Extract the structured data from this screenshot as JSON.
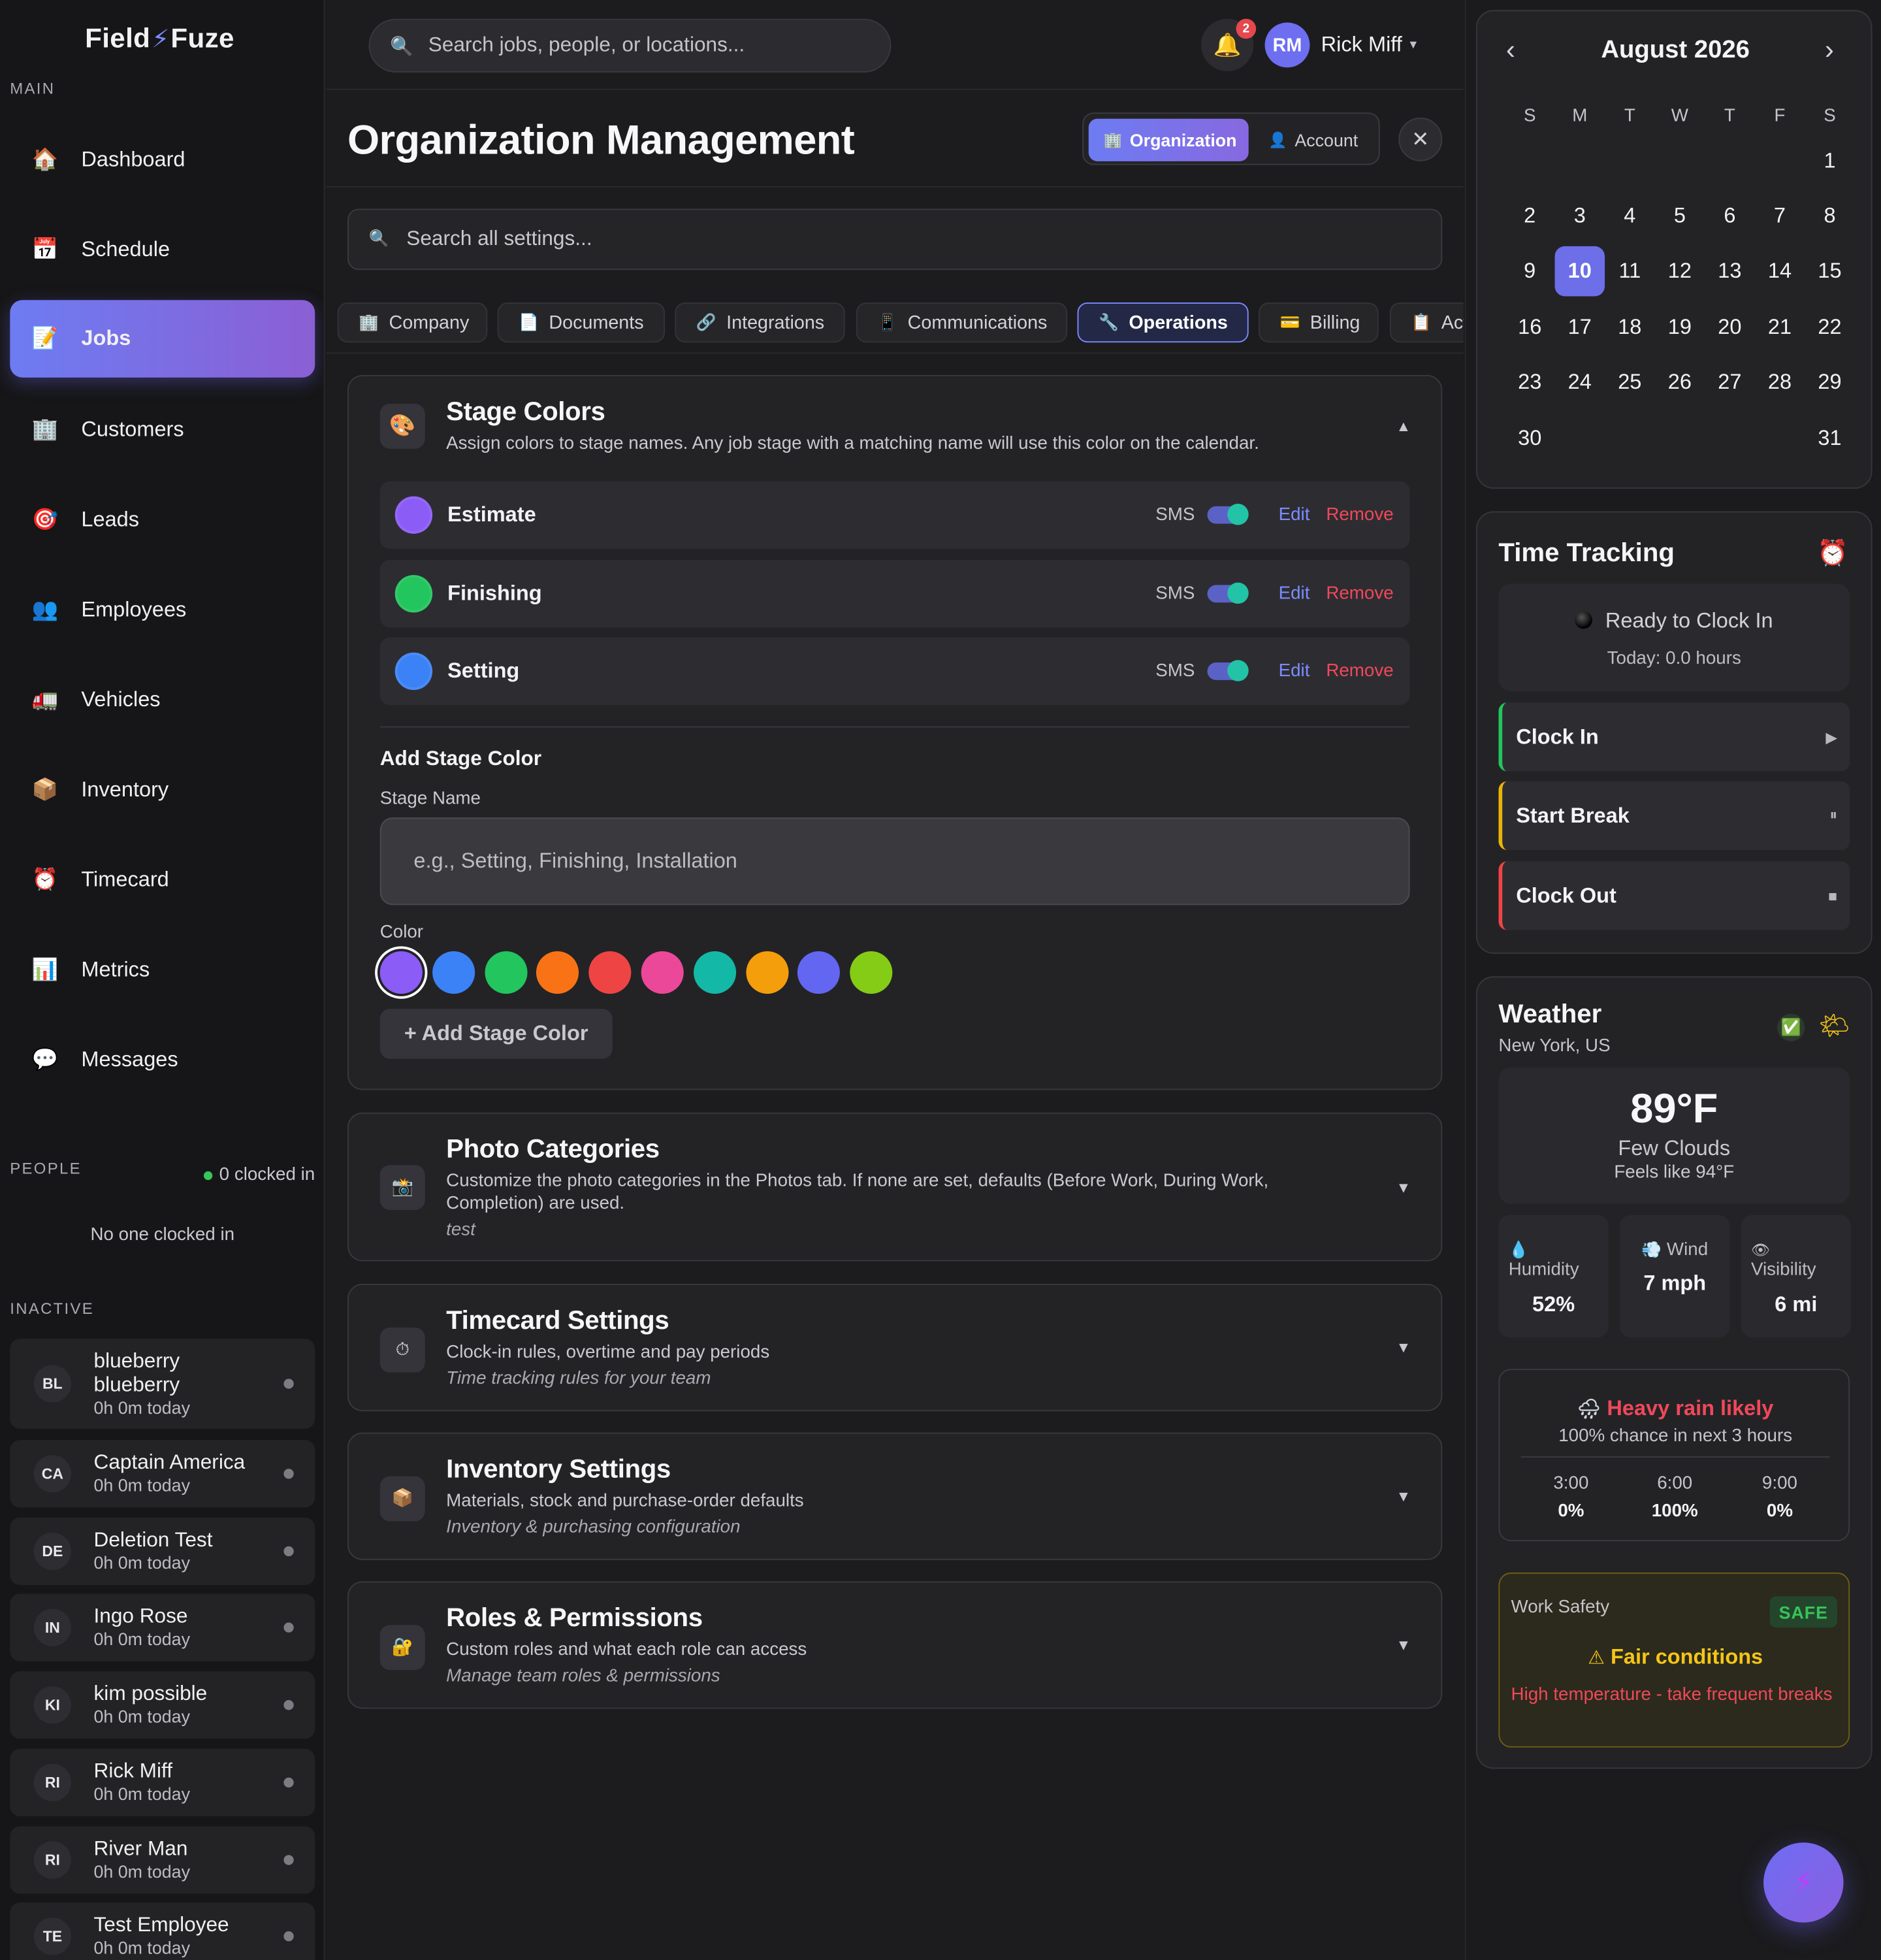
{
  "app": {
    "logo_left": "Field",
    "logo_right": "Fuze"
  },
  "sidebar": {
    "main_label": "MAIN",
    "items": [
      {
        "label": "Dashboard",
        "icon": "house-icon",
        "glyph": "🏠"
      },
      {
        "label": "Schedule",
        "icon": "calendar-icon",
        "glyph": "📅"
      },
      {
        "label": "Jobs",
        "icon": "memo-icon",
        "glyph": "📝",
        "active": true
      },
      {
        "label": "Customers",
        "icon": "office-building-icon",
        "glyph": "🏢"
      },
      {
        "label": "Leads",
        "icon": "target-icon",
        "glyph": "🎯"
      },
      {
        "label": "Employees",
        "icon": "people-icon",
        "glyph": "👥"
      },
      {
        "label": "Vehicles",
        "icon": "truck-icon",
        "glyph": "🚛"
      },
      {
        "label": "Inventory",
        "icon": "package-icon",
        "glyph": "📦"
      },
      {
        "label": "Timecard",
        "icon": "alarm-clock-icon",
        "glyph": "⏰"
      },
      {
        "label": "Metrics",
        "icon": "bar-chart-icon",
        "glyph": "📊"
      },
      {
        "label": "Messages",
        "icon": "speech-bubble-icon",
        "glyph": "💬"
      }
    ],
    "people_label": "PEOPLE",
    "clocked_in": "0 clocked in",
    "no_one": "No one clocked in",
    "inactive_label": "INACTIVE",
    "employees": [
      {
        "initials": "BL",
        "name": "blueberry blueberry",
        "sub": "0h 0m today"
      },
      {
        "initials": "CA",
        "name": "Captain America",
        "sub": "0h 0m today"
      },
      {
        "initials": "DE",
        "name": "Deletion Test",
        "sub": "0h 0m today"
      },
      {
        "initials": "IN",
        "name": "Ingo Rose",
        "sub": "0h 0m today"
      },
      {
        "initials": "KI",
        "name": "kim possible",
        "sub": "0h 0m today"
      },
      {
        "initials": "RI",
        "name": "Rick Miff",
        "sub": "0h 0m today"
      },
      {
        "initials": "RI",
        "name": "River Man",
        "sub": "0h 0m today"
      },
      {
        "initials": "TE",
        "name": "Test Employee",
        "sub": "0h 0m today"
      }
    ]
  },
  "topbar": {
    "search_placeholder": "Search jobs, people, or locations...",
    "notifications": "2",
    "user_initials": "RM",
    "user_name": "Rick Miff",
    "caret": "▾"
  },
  "page": {
    "title": "Organization Management",
    "seg_org": "Organization",
    "seg_account": "Account",
    "close": "✕",
    "settings_search_placeholder": "Search all settings...",
    "tabs": [
      {
        "label": "Company",
        "icon": "building-icon",
        "glyph": "🏢"
      },
      {
        "label": "Documents",
        "icon": "document-icon",
        "glyph": "📄"
      },
      {
        "label": "Integrations",
        "icon": "link-icon",
        "glyph": "🔗"
      },
      {
        "label": "Communications",
        "icon": "mobile-icon",
        "glyph": "📱"
      },
      {
        "label": "Operations",
        "icon": "wrench-icon",
        "glyph": "🔧",
        "active": true
      },
      {
        "label": "Billing",
        "icon": "credit-card-icon",
        "glyph": "💳"
      },
      {
        "label": "Activity",
        "icon": "clipboard-icon",
        "glyph": "📋"
      }
    ]
  },
  "stage_colors": {
    "title": "Stage Colors",
    "desc": "Assign colors to stage names. Any job stage with a matching name will use this color on the calendar.",
    "caret": "▲",
    "sms": "SMS",
    "edit": "Edit",
    "remove": "Remove",
    "stages": [
      {
        "name": "Estimate",
        "color": "#8b5cf6"
      },
      {
        "name": "Finishing",
        "color": "#22c55e"
      },
      {
        "name": "Setting",
        "color": "#3b82f6"
      }
    ],
    "add_title": "Add Stage Color",
    "stage_name_label": "Stage Name",
    "stage_name_placeholder": "e.g., Setting, Finishing, Installation",
    "color_label": "Color",
    "swatches": [
      "#8b5cf6",
      "#3b82f6",
      "#22c55e",
      "#f97316",
      "#ef4444",
      "#ec4899",
      "#14b8a6",
      "#f59e0b",
      "#6366f1",
      "#84cc16"
    ],
    "selected_swatch": 0,
    "add_button": "+ Add Stage Color"
  },
  "sections": [
    {
      "title": "Photo Categories",
      "desc": "Customize the photo categories in the Photos tab. If none are set, defaults (Before Work, During Work, Completion) are used.",
      "note": "test",
      "icon": "camera-icon",
      "glyph": "📸"
    },
    {
      "title": "Timecard Settings",
      "desc": "Clock-in rules, overtime and pay periods",
      "note": "Time tracking rules for your team",
      "icon": "stopwatch-icon",
      "glyph": "⏱"
    },
    {
      "title": "Inventory Settings",
      "desc": "Materials, stock and purchase-order defaults",
      "note": "Inventory & purchasing configuration",
      "icon": "package-icon",
      "glyph": "📦"
    },
    {
      "title": "Roles & Permissions",
      "desc": "Custom roles and what each role can access",
      "note": "Manage team roles & permissions",
      "icon": "lock-icon",
      "glyph": "🔐"
    }
  ],
  "calendar": {
    "month": "August 2026",
    "prev": "‹",
    "next": "›",
    "dow": [
      "S",
      "M",
      "T",
      "W",
      "T",
      "F",
      "S"
    ],
    "today": "10",
    "days": [
      [
        "",
        "",
        "",
        "",
        "",
        "",
        "1"
      ],
      [
        "2",
        "3",
        "4",
        "5",
        "6",
        "7",
        "8"
      ],
      [
        "9",
        "10",
        "11",
        "12",
        "13",
        "14",
        "15"
      ],
      [
        "16",
        "17",
        "18",
        "19",
        "20",
        "21",
        "22"
      ],
      [
        "23",
        "24",
        "25",
        "26",
        "27",
        "28",
        "29"
      ],
      [
        "30",
        "",
        "",
        "",
        "",
        "",
        "31"
      ]
    ]
  },
  "time_tracking": {
    "title": "Time Tracking",
    "status": "Ready to Clock In",
    "today": "Today: 0.0 hours",
    "buttons": [
      {
        "label": "Clock In",
        "symbol": "▶",
        "accent": "#22c55e"
      },
      {
        "label": "Start Break",
        "symbol": "⏸",
        "accent": "#eab308"
      },
      {
        "label": "Clock Out",
        "symbol": "■",
        "accent": "#ef4444"
      }
    ]
  },
  "weather": {
    "title": "Weather",
    "location": "New York, US",
    "temp": "89°F",
    "condition": "Few Clouds",
    "feels": "Feels like 94°F",
    "humidity_label": "Humidity",
    "humidity": "52%",
    "wind_label": "Wind",
    "wind": "7 mph",
    "visibility_label": "Visibility",
    "visibility": "6 mi",
    "rain_title": "Heavy rain likely",
    "rain_sub": "100% chance in next 3 hours",
    "forecast": [
      {
        "time": "3:00",
        "pct": "0%"
      },
      {
        "time": "6:00",
        "pct": "100%"
      },
      {
        "time": "9:00",
        "pct": "0%"
      }
    ],
    "safety_title": "Work Safety",
    "safety_badge": "SAFE",
    "safety_condition": "Fair conditions",
    "safety_warning": "High temperature - take frequent breaks"
  }
}
